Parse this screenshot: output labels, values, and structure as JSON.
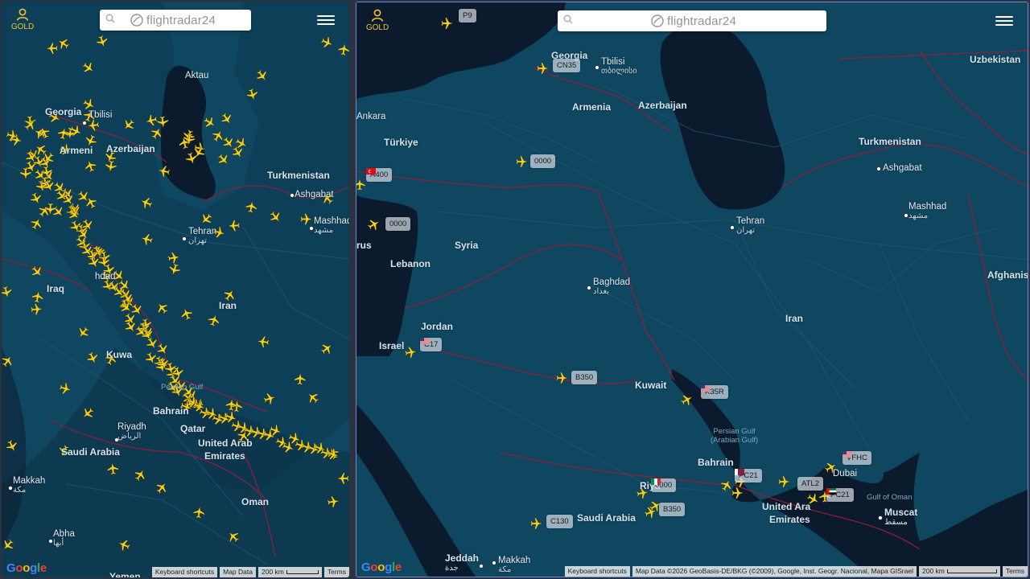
{
  "brand": {
    "logo_text": "flightradar24",
    "gold_label": "GOLD",
    "search_icon": "search-icon",
    "menu_icon": "hamburger-menu-icon"
  },
  "colors": {
    "sea": "#0f4760",
    "land": "#0b1a2c",
    "border": "#8c1f3a",
    "plane": "#f7d117",
    "accent": "#f2c23a"
  },
  "left_map": {
    "labels": {
      "georgia": "Georgia",
      "armenia": "Armeni",
      "azerbaijan": "Azerbaijan",
      "turkmenistan": "Turkmenistan",
      "iraq": "Iraq",
      "iran": "Iran",
      "kuwait": "Kuwa",
      "bahrain": "Bahrain",
      "qatar": "Qatar",
      "uae1": "United Arab",
      "uae2": "Emirates",
      "saudi": "Saudi Arabia",
      "oman": "Oman",
      "yemen": "Yemen"
    },
    "cities": {
      "tbilisi": "Tbilisi",
      "aktau": "Aktau",
      "ashgabat": "Ashgabat",
      "mashhad": "Mashhad",
      "mashhad_local": "مشهد",
      "tehran": "Tehran",
      "tehran_local": "تهران",
      "baghdad": "hdad",
      "riyadh": "Riyadh",
      "riyadh_local": "الرياض",
      "makkah": "Makkah",
      "makkah_local": "مكة",
      "abha": "Abha",
      "abha_local": "أبها"
    },
    "sea_label_1": "Persian Gulf",
    "footer": {
      "shortcuts": "Keyboard shortcuts",
      "map_data": "Map Data",
      "scale": "200 km",
      "terms": "Terms"
    }
  },
  "right_map": {
    "labels": {
      "georgia": "Georgia",
      "armenia": "Armenia",
      "azerbaijan": "Azerbaijan",
      "turkiye": "Türkiye",
      "ankara": "Ankara",
      "uzbekistan": "Uzbekistan",
      "turkmenistan": "Turkmenistan",
      "syria": "Syria",
      "lebanon": "Lebanon",
      "cyprus": "rus",
      "jordan": "Jordan",
      "israel": "Israel",
      "iran": "Iran",
      "afghanistan": "Afghanis",
      "kuwait": "Kuwait",
      "bahrain": "Bahrain",
      "saudi": "Saudi Arabia",
      "riyadh_part": "Riya",
      "uae1": "United Ara",
      "uae2": "Emirates",
      "muscat": "Muscat",
      "muscat_local": "مسقط",
      "jeddah": "Jeddah",
      "jeddah_local": "جدة",
      "makkah": "Makkah",
      "makkah_local": "مكة"
    },
    "cities": {
      "tbilisi": "Tbilisi",
      "tbilisi_local": "თბილისი",
      "ashgabat": "Ashgabat",
      "mashhad": "Mashhad",
      "mashhad_local": "مشهد",
      "tehran": "Tehran",
      "tehran_local": "تهران",
      "baghdad": "Baghdad",
      "baghdad_local": "بغداد",
      "dubai": "Dubai"
    },
    "sea_persian_1": "Persian Gulf",
    "sea_persian_2": "(Arabian Gulf)",
    "sea_oman": "Gulf of Oman",
    "tags": {
      "p9": "P9",
      "cn35": "CN35",
      "a400": "A400",
      "t0000a": "0000",
      "t0000b": "0000",
      "c17": "C17",
      "b350a": "B350",
      "k35r": "K35R",
      "vfhc": "VFHC",
      "atl2": "ATL2",
      "pc21a": "PC21",
      "pc21b": "PC21",
      "t0000c": "0000",
      "b350b": "B350",
      "c130": "C130"
    },
    "footer": {
      "shortcuts": "Keyboard shortcuts",
      "attribution": "Map Data ©2026 GeoBasis-DE/BKG (©2009), Google, Inst. Geogr. Nacional, Mapa GISrael",
      "scale": "200 km",
      "terms": "Terms"
    }
  }
}
